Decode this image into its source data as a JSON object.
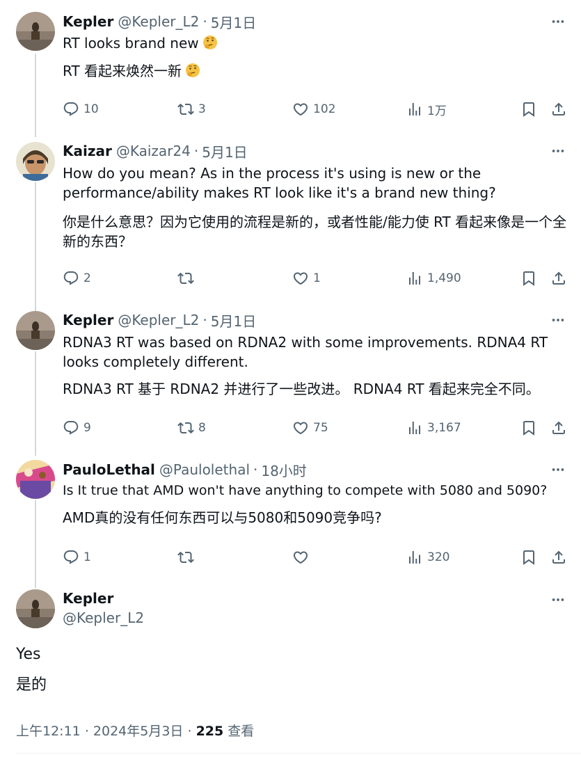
{
  "tweets": [
    {
      "name": "Kepler",
      "handle": "@Kepler_L2",
      "sep": "·",
      "time": "5月1日",
      "text": "RT looks brand new",
      "translation": "RT 看起来焕然一新",
      "replies": "10",
      "retweets": "3",
      "likes": "102",
      "views": "1万"
    },
    {
      "name": "Kaizar",
      "handle": "@Kaizar24",
      "sep": "·",
      "time": "5月1日",
      "text": "How do you mean? As in the process it's using is new or the performance/ability makes RT look like it's a brand new thing?",
      "translation": "你是什么意思？因为它使用的流程是新的，或者性能/能力使 RT 看起来像是一个全新的东西？",
      "replies": "2",
      "retweets": "",
      "likes": "1",
      "views": "1,490"
    },
    {
      "name": "Kepler",
      "handle": "@Kepler_L2",
      "sep": "·",
      "time": "5月1日",
      "text": "RDNA3 RT was based on RDNA2 with some improvements. RDNA4 RT looks completely different.",
      "translation": "RDNA3 RT 基于 RDNA2 并进行了一些改进。 RDNA4 RT 看起来完全不同。",
      "replies": "9",
      "retweets": "8",
      "likes": "75",
      "views": "3,167"
    },
    {
      "name": "PauloLethal",
      "handle": "@Paulolethal",
      "sep": "·",
      "time": "18小时",
      "text": "Is It true that AMD won't have anything to compete with 5080 and 5090?",
      "translation": "AMD真的没有任何东西可以与5080和5090竞争吗?",
      "replies": "1",
      "retweets": "",
      "likes": "",
      "views": "320"
    }
  ],
  "main": {
    "name": "Kepler",
    "handle": "@Kepler_L2",
    "text": "Yes",
    "translation": "是的",
    "time": "上午12:11",
    "sep1": "·",
    "date": "2024年5月3日",
    "sep2": "·",
    "views_count": "225",
    "views_label": "查看"
  },
  "colors": {
    "text": "#0f1419",
    "secondary": "#536471",
    "thread_line": "#cfd9de"
  }
}
